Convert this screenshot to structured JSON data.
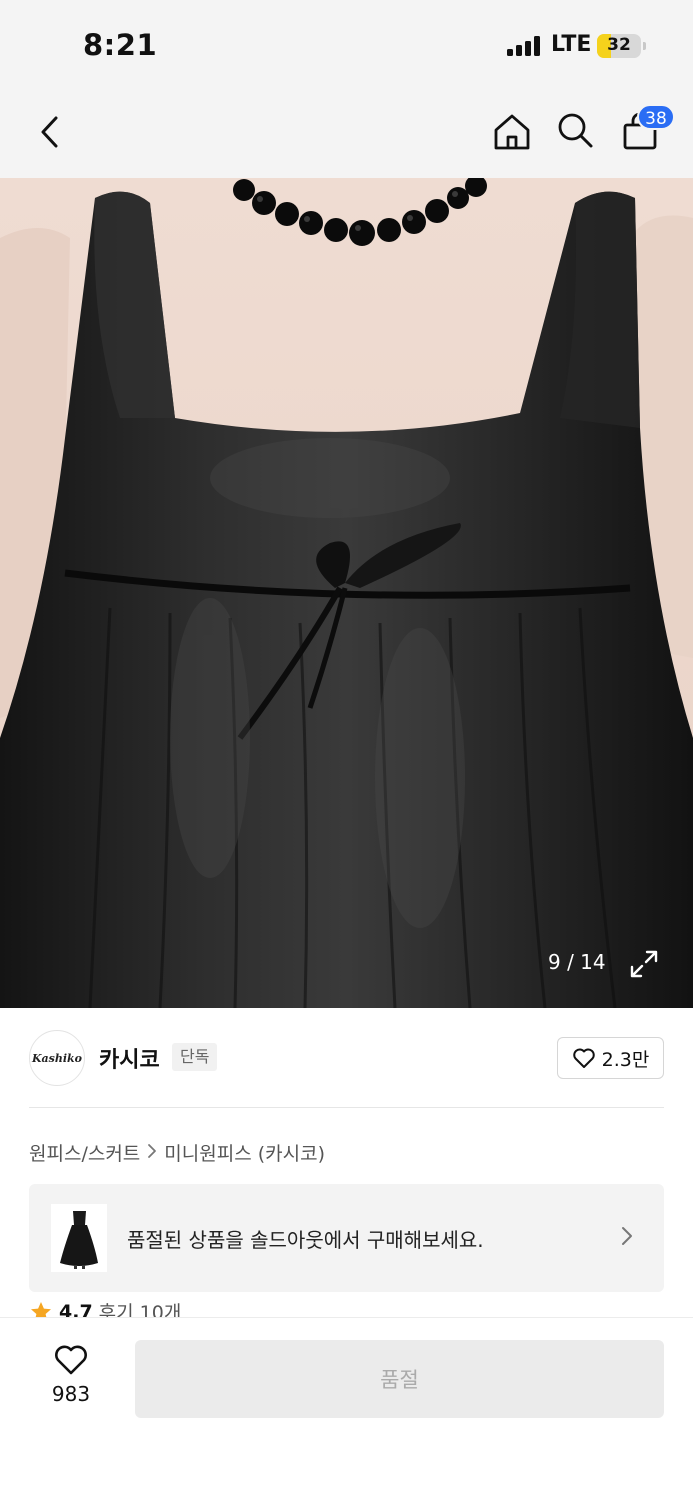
{
  "status_bar": {
    "time": "8:21",
    "network": "LTE",
    "battery": "32",
    "battery_level": 0.32,
    "battery_color": "#f5d21c"
  },
  "nav": {
    "back_icon": "chevron-left-icon",
    "home_icon": "home-icon",
    "search_icon": "search-icon",
    "cart_icon": "shopping-bag-icon",
    "cart_count": "38",
    "badge_color": "#2a6df4"
  },
  "product_image": {
    "description_icon": "product-photo",
    "counter": "9 / 14",
    "expand_icon": "expand-icon"
  },
  "brand": {
    "logo_text": "Kashiko",
    "name": "카시코",
    "tag": "단독",
    "likes": "2.3만"
  },
  "breadcrumb": {
    "items": [
      "원피스/스커트",
      "미니원피스 (카시코)"
    ]
  },
  "soldout_banner": {
    "text": "품절된 상품을 솔드아웃에서 구매해보세요."
  },
  "rating": {
    "value": "4.7",
    "reviews": "후기 10개",
    "star_color": "#f5a623"
  },
  "bottom_bar": {
    "wish_count": "983",
    "buy_label": "품절"
  }
}
